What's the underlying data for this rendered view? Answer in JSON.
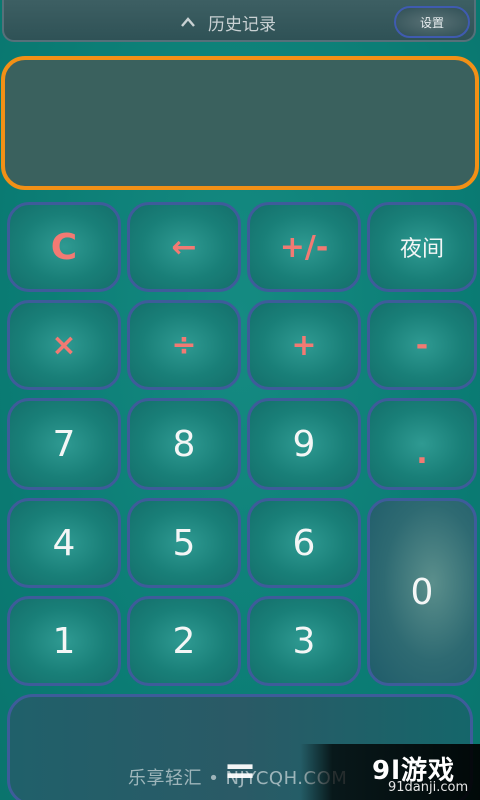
{
  "topbar": {
    "history_label": "历史记录",
    "settings_label": "设置"
  },
  "display": {
    "value": ""
  },
  "keys": {
    "row1": [
      "C",
      "←",
      "+/-",
      "夜间"
    ],
    "row2": [
      "×",
      "÷",
      "+",
      "-"
    ],
    "row3": [
      "7",
      "8",
      "9",
      "."
    ],
    "row4": [
      "4",
      "5",
      "6"
    ],
    "row5": [
      "1",
      "2",
      "3"
    ],
    "zero": "0",
    "equals": "="
  },
  "watermark": {
    "site_text": "乐享轻汇 • NJYCQH.COM",
    "logo_title": "9l游戏",
    "logo_sub": "91danji.com"
  },
  "colors": {
    "background": "#0d8178",
    "display_border": "#f29016",
    "key_border": "#3e5c9a",
    "operator_text": "#f27a73",
    "number_text": "#f4f6f6"
  }
}
